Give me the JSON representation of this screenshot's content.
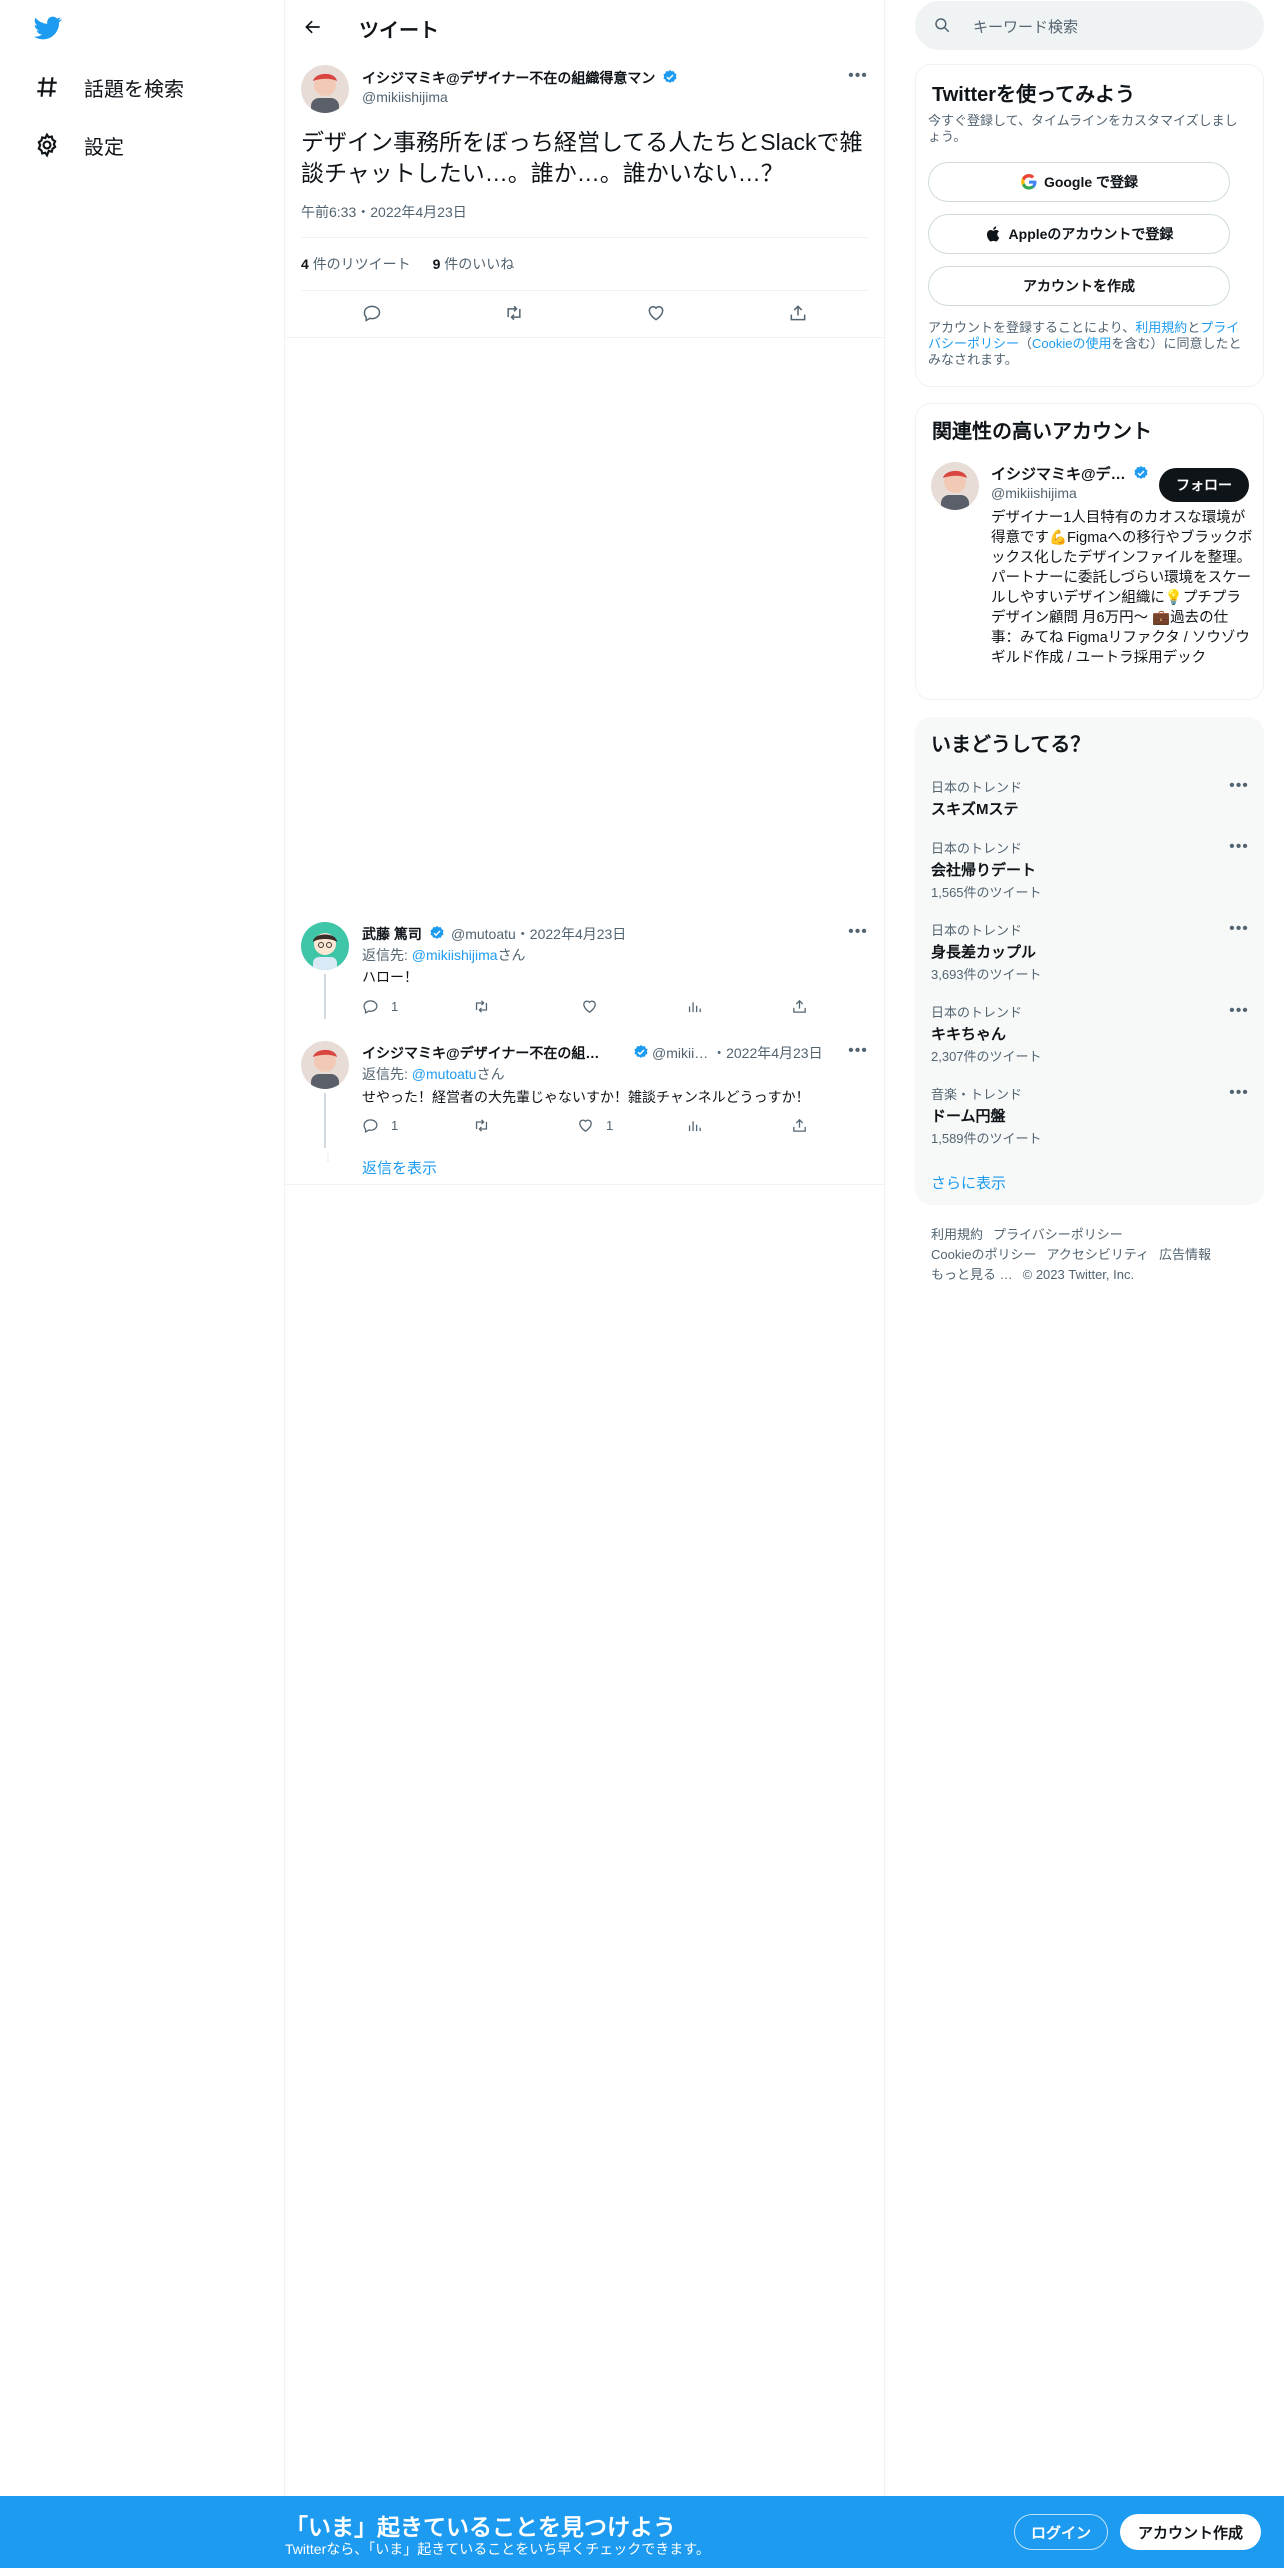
{
  "nav": {
    "logo": "twitter-bird-icon",
    "items": [
      {
        "icon": "hashtag-icon",
        "label": "話題を検索"
      },
      {
        "icon": "gear-icon",
        "label": "設定"
      }
    ]
  },
  "header": {
    "title": "ツイート"
  },
  "main_tweet": {
    "author_name": "イシジマミキ@デザイナー不在の組織得意マン",
    "handle": "@mikiishijima",
    "text": "デザイン事務所をぼっち経営してる人たちとSlackで雑談チャットしたい…。誰か…。誰かいない…？",
    "time": "午前6:33・2022年4月23日",
    "retweet_count": "4",
    "retweet_label": "件のリツイート",
    "like_count": "9",
    "like_label": "件のいいね"
  },
  "replies": [
    {
      "name": "武藤 篤司",
      "meta": "@mutoatu・2022年4月23日",
      "reply_prefix": "返信先: ",
      "reply_to": "@mikiishijima",
      "reply_suffix": "さん",
      "text": "ハロー！",
      "reply_count": "1",
      "like_count": ""
    },
    {
      "name": "イシジマミキ@デザイナー不在の組…",
      "meta": "@mikii… ・2022年4月23日",
      "reply_prefix": "返信先: ",
      "reply_to": "@mutoatu",
      "reply_suffix": "さん",
      "text": "せやった！経営者の大先輩じゃないすか！雑談チャンネルどうっすか！",
      "reply_count": "1",
      "like_count": "1"
    }
  ],
  "show_replies": "返信を表示",
  "search": {
    "placeholder": "キーワード検索"
  },
  "signup": {
    "title": "Twitterを使ってみよう",
    "desc": "今すぐ登録して、タイムラインをカスタマイズしましょう。",
    "google": "Google で登録",
    "apple": "Appleのアカウントで登録",
    "create": "アカウントを作成",
    "terms_prefix": "アカウントを登録することにより、",
    "terms_link": "利用規約",
    "terms_and": "と",
    "privacy_link": "プライバシーポリシー",
    "terms_mid": "（",
    "cookie_link": "Cookieの使用",
    "terms_suffix": "を含む）に同意したとみなされます。"
  },
  "related": {
    "title": "関連性の高いアカウント",
    "name": "イシジマミキ@デ…",
    "handle": "@mikiishijima",
    "follow": "フォロー",
    "bio": "デザイナー1人目特有のカオスな環境が得意です💪Figmaへの移行やブラックボックス化したデザインファイルを整理。パートナーに委託しづらい環境をスケールしやすいデザイン組織に💡プチプラ デザイン顧問 月6万円〜 💼過去の仕事：みてね Figmaリファクタ / ソウゾウ ギルド作成 / ユートラ採用デック"
  },
  "trends": {
    "title": "いまどうしてる？",
    "items": [
      {
        "category": "日本のトレンド",
        "name": "スキズMステ",
        "count": ""
      },
      {
        "category": "日本のトレンド",
        "name": "会社帰りデート",
        "count": "1,565件のツイート"
      },
      {
        "category": "日本のトレンド",
        "name": "身長差カップル",
        "count": "3,693件のツイート"
      },
      {
        "category": "日本のトレンド",
        "name": "キキちゃん",
        "count": "2,307件のツイート"
      },
      {
        "category": "音楽・トレンド",
        "name": "ドーム円盤",
        "count": "1,589件のツイート"
      }
    ],
    "show_more": "さらに表示"
  },
  "footer": {
    "terms": "利用規約",
    "privacy": "プライバシーポリシー",
    "cookie": "Cookieのポリシー",
    "accessibility": "アクセシビリティ",
    "ads": "広告情報",
    "more": "もっと見る …",
    "copyright": "© 2023 Twitter, Inc."
  },
  "banner": {
    "title": "「いま」起きていることを見つけよう",
    "subtitle": "Twitterなら、「いま」起きていることをいち早くチェックできます。",
    "login": "ログイン",
    "create": "アカウント作成"
  },
  "colors": {
    "accent": "#1d9bf0",
    "text": "#0f1419",
    "muted": "#536471",
    "border": "#eff3f4"
  }
}
